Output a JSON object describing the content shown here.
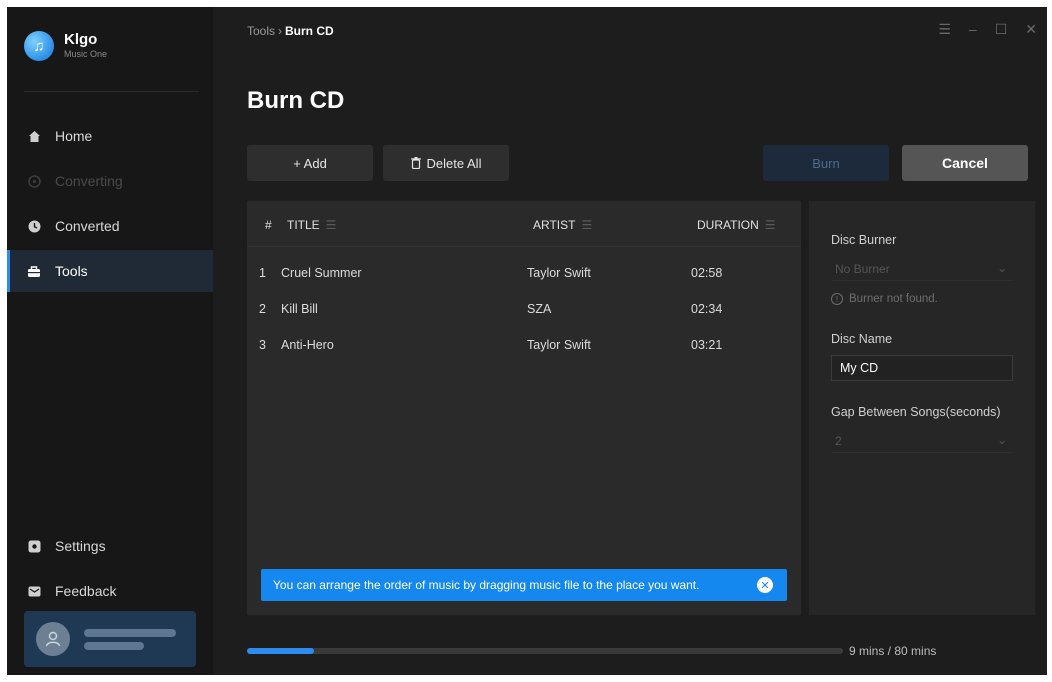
{
  "app": {
    "name": "Klgo",
    "subtitle": "Music One",
    "logo_glyph": "♫"
  },
  "sidebar": {
    "items": [
      {
        "label": "Home",
        "icon": "home-icon",
        "state": "normal"
      },
      {
        "label": "Converting",
        "icon": "converting-icon",
        "state": "disabled"
      },
      {
        "label": "Converted",
        "icon": "clock-icon",
        "state": "normal"
      },
      {
        "label": "Tools",
        "icon": "toolbox-icon",
        "state": "active"
      }
    ],
    "bottom_items": [
      {
        "label": "Settings",
        "icon": "gear-icon"
      },
      {
        "label": "Feedback",
        "icon": "mail-icon"
      }
    ]
  },
  "breadcrumb": {
    "parent": "Tools",
    "separator": "›",
    "current": "Burn CD"
  },
  "window_controls": {
    "menu": "☰",
    "minimize": "–",
    "maximize": "☐",
    "close": "✕"
  },
  "page": {
    "title": "Burn CD"
  },
  "toolbar": {
    "add_label": "+ Add",
    "delete_all_label": "Delete All",
    "burn_label": "Burn",
    "cancel_label": "Cancel"
  },
  "table": {
    "columns": {
      "index": "#",
      "title": "TITLE",
      "artist": "ARTIST",
      "duration": "DURATION"
    },
    "rows": [
      {
        "index": "1",
        "title": "Cruel Summer",
        "artist": "Taylor Swift",
        "duration": "02:58"
      },
      {
        "index": "2",
        "title": "Kill Bill",
        "artist": "SZA",
        "duration": "02:34"
      },
      {
        "index": "3",
        "title": "Anti-Hero",
        "artist": "Taylor Swift",
        "duration": "03:21"
      }
    ]
  },
  "tip": {
    "text": "You can arrange the order of music by dragging music file to the place you want."
  },
  "burn_settings": {
    "disc_burner_label": "Disc Burner",
    "disc_burner_value": "No Burner",
    "burner_warning": "Burner not found.",
    "disc_name_label": "Disc Name",
    "disc_name_value": "My CD",
    "gap_label": "Gap Between Songs(seconds)",
    "gap_value": "2"
  },
  "capacity": {
    "text": "9 mins / 80 mins",
    "used_minutes": 9,
    "total_minutes": 80
  },
  "colors": {
    "accent": "#2d8cf0",
    "background": "#1d1d1d",
    "sidebar": "#171717",
    "tip": "#1488ee"
  }
}
